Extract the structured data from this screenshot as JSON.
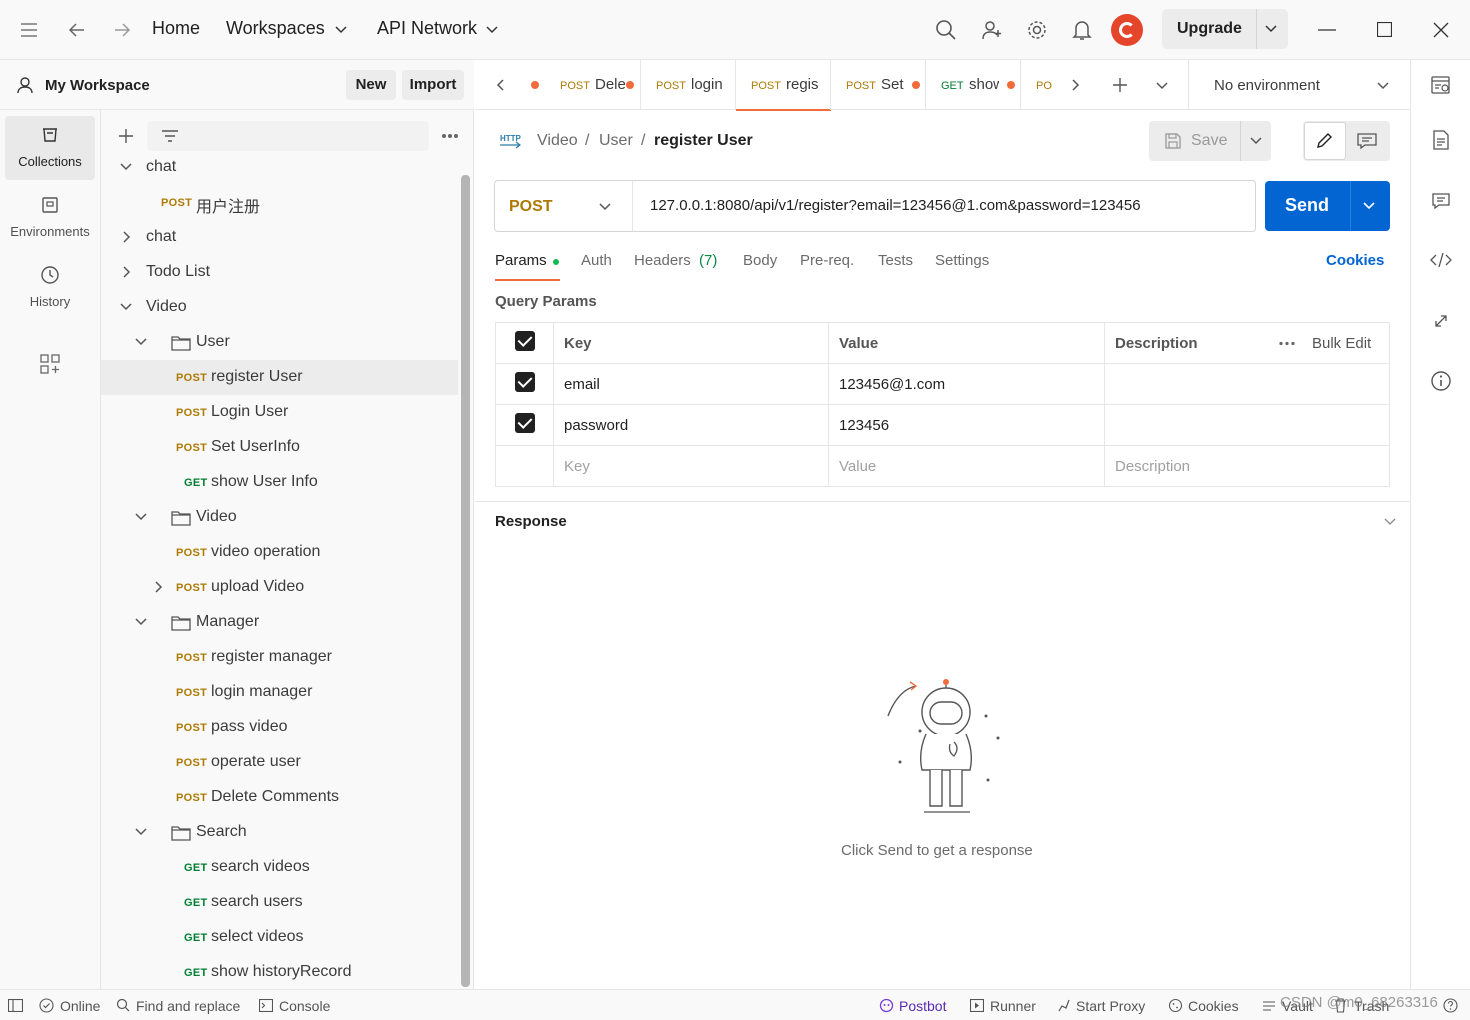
{
  "titlebar": {
    "home": "Home",
    "workspaces": "Workspaces",
    "api_network": "API Network",
    "upgrade": "Upgrade"
  },
  "rail": {
    "collections": "Collections",
    "environments": "Environments",
    "history": "History"
  },
  "workspace": {
    "name": "My Workspace",
    "new_label": "New",
    "import_label": "Import"
  },
  "tree": [
    {
      "type": "collection",
      "expanded": true,
      "name": "chat"
    },
    {
      "type": "request",
      "method": "POST",
      "name": "用户注册"
    },
    {
      "type": "collection",
      "expanded": false,
      "name": "chat"
    },
    {
      "type": "collection",
      "expanded": false,
      "name": "Todo List"
    },
    {
      "type": "collection",
      "expanded": true,
      "name": "Video"
    },
    {
      "type": "folder",
      "expanded": true,
      "name": "User"
    },
    {
      "type": "request",
      "method": "POST",
      "name": "register User",
      "selected": true
    },
    {
      "type": "request",
      "method": "POST",
      "name": "Login User"
    },
    {
      "type": "request",
      "method": "POST",
      "name": "Set UserInfo"
    },
    {
      "type": "request",
      "method": "GET",
      "name": "show User Info"
    },
    {
      "type": "folder",
      "expanded": true,
      "name": "Video"
    },
    {
      "type": "request",
      "method": "POST",
      "name": "video operation"
    },
    {
      "type": "request",
      "method": "POST",
      "name": "upload Video",
      "has_children": true
    },
    {
      "type": "folder",
      "expanded": true,
      "name": "Manager"
    },
    {
      "type": "request",
      "method": "POST",
      "name": "register manager"
    },
    {
      "type": "request",
      "method": "POST",
      "name": "login manager"
    },
    {
      "type": "request",
      "method": "POST",
      "name": "pass video"
    },
    {
      "type": "request",
      "method": "POST",
      "name": "operate user"
    },
    {
      "type": "request",
      "method": "POST",
      "name": "Delete Comments"
    },
    {
      "type": "folder",
      "expanded": true,
      "name": "Search"
    },
    {
      "type": "request",
      "method": "GET",
      "name": "search videos"
    },
    {
      "type": "request",
      "method": "GET",
      "name": "search users"
    },
    {
      "type": "request",
      "method": "GET",
      "name": "select videos"
    },
    {
      "type": "request",
      "method": "GET",
      "name": "show historyRecord"
    }
  ],
  "tabs": [
    {
      "method": "POST",
      "name": "Dele",
      "dot": true
    },
    {
      "method": "POST",
      "name": "login",
      "dot": false
    },
    {
      "method": "POST",
      "name": "regis",
      "dot": false,
      "active": true
    },
    {
      "method": "POST",
      "name": "Set",
      "dot": true
    },
    {
      "method": "GET",
      "name": "show",
      "dot": true
    },
    {
      "method": "PO",
      "name": "",
      "dot": false
    }
  ],
  "environment": "No environment",
  "breadcrumb": {
    "part1": "Video",
    "part2": "User",
    "current": "register User",
    "sep": "/"
  },
  "toolbar": {
    "save_label": "Save"
  },
  "request": {
    "method": "POST",
    "url": "127.0.0.1:8080/api/v1/register?email=123456@1.com&password=123456",
    "send_label": "Send"
  },
  "request_tabs": {
    "params": "Params",
    "auth": "Auth",
    "headers": "Headers",
    "headers_count": "(7)",
    "body": "Body",
    "prereq": "Pre-req.",
    "tests": "Tests",
    "settings": "Settings",
    "cookies": "Cookies"
  },
  "query_params": {
    "title": "Query Params",
    "col_key": "Key",
    "col_value": "Value",
    "col_description": "Description",
    "bulk_edit": "Bulk Edit",
    "rows": [
      {
        "key": "email",
        "value": "123456@1.com",
        "description": ""
      },
      {
        "key": "password",
        "value": "123456",
        "description": ""
      }
    ],
    "placeholder_key": "Key",
    "placeholder_value": "Value",
    "placeholder_description": "Description"
  },
  "response": {
    "title": "Response",
    "empty_text": "Click Send to get a response"
  },
  "statusbar": {
    "online": "Online",
    "find_replace": "Find and replace",
    "console": "Console",
    "postbot": "Postbot",
    "runner": "Runner",
    "start_proxy": "Start Proxy",
    "cookies": "Cookies",
    "vault": "Vault",
    "trash": "Trash",
    "watermark": "CSDN @m0_68263316"
  },
  "colors": {
    "post": "#ad7a03",
    "get": "#007f31",
    "send_blue": "#0265d2",
    "accent_orange": "#f26b3a"
  }
}
